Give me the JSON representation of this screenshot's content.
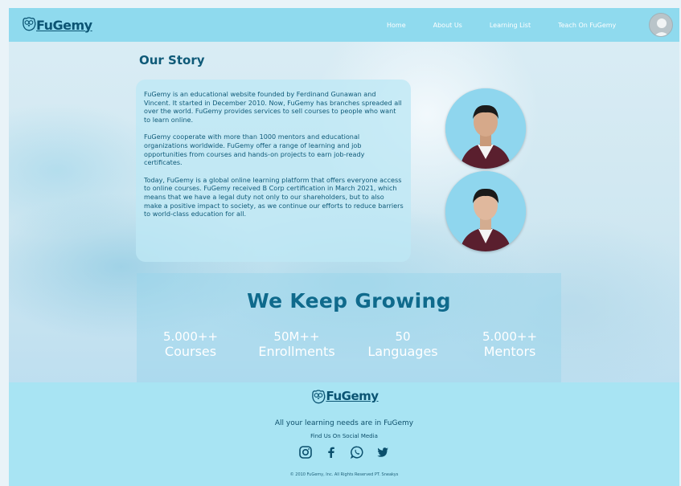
{
  "brand": {
    "name": "FuGemy"
  },
  "nav": {
    "links": [
      "Home",
      "About Us",
      "Learning List",
      "Teach On FuGemy"
    ]
  },
  "story": {
    "title": "Our Story",
    "paragraphs": [
      "FuGemy is an educational website founded by Ferdinand Gunawan and Vincent. It started in December 2010. Now, FuGemy has branches spreaded all over the world. FuGemy provides services to sell courses to people who want to learn online.",
      "FuGemy cooperate with more than 1000 mentors and educational organizations worldwide. FuGemy offer a range of learning and job opportunities from courses and hands-on projects to earn job-ready certificates.",
      "Today, FuGemy is a global online learning platform that offers everyone access to online courses. FuGemy received B Corp certification in March 2021, which means that we have a legal duty not only to our shareholders, but to also make a positive impact to society, as we continue our efforts to reduce barriers to world-class education for all."
    ]
  },
  "growing": {
    "title": "We Keep Growing",
    "stats": [
      {
        "value": "5.000++",
        "label": "Courses"
      },
      {
        "value": "50M++",
        "label": "Enrollments"
      },
      {
        "value": "50",
        "label": "Languages"
      },
      {
        "value": "5.000++",
        "label": "Mentors"
      }
    ]
  },
  "footer": {
    "tagline": "All your learning needs are in FuGemy",
    "social_heading": "Find Us On Social Media",
    "social_icons": [
      "instagram-icon",
      "facebook-icon",
      "whatsapp-icon",
      "twitter-icon"
    ],
    "copyright": "© 2010 FuGemy, Inc. All Rights Reserved PT. Sneakys"
  },
  "colors": {
    "nav_bg": "#8fdaee",
    "footer_bg": "#a8e4f3",
    "primary_text": "#0f5a78"
  }
}
